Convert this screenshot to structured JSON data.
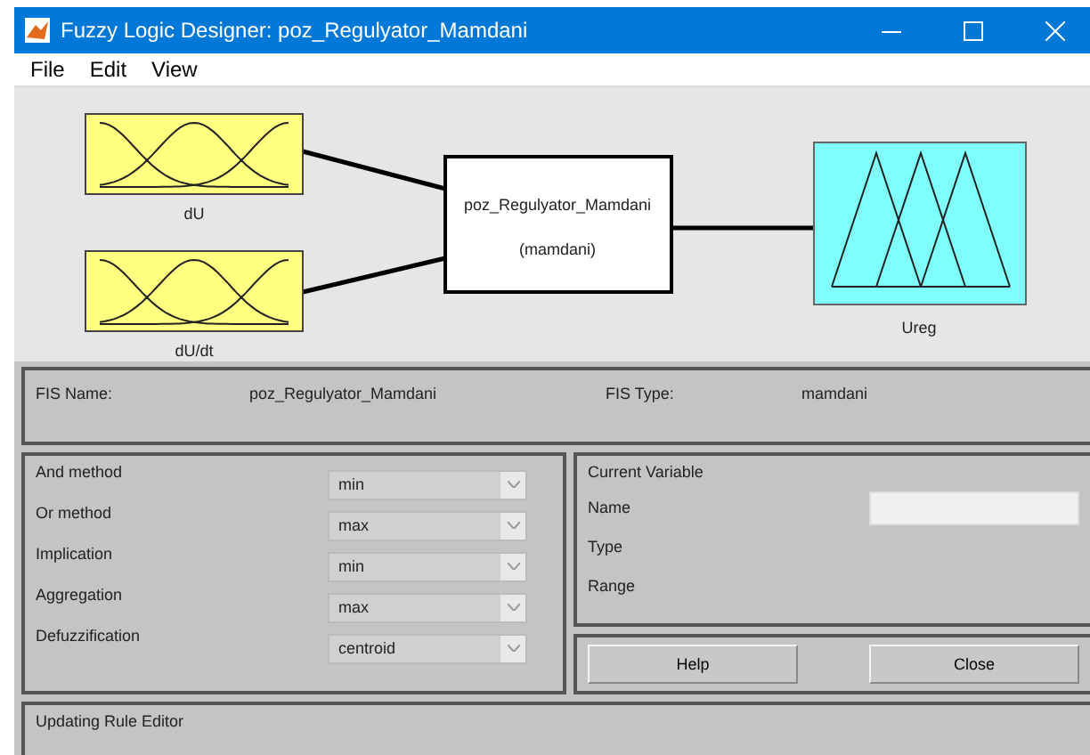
{
  "window": {
    "title": "Fuzzy Logic Designer: poz_Regulyator_Mamdani"
  },
  "menu": [
    "File",
    "Edit",
    "View"
  ],
  "diagram": {
    "inputs": [
      {
        "name": "dU"
      },
      {
        "name": "dU/dt"
      }
    ],
    "system": {
      "name": "poz_Regulyator_Mamdani",
      "type": "(mamdani)"
    },
    "outputs": [
      {
        "name": "Ureg"
      }
    ]
  },
  "fis_info": {
    "name_label": "FIS Name:",
    "name_value": "poz_Regulyator_Mamdani",
    "type_label": "FIS Type:",
    "type_value": "mamdani"
  },
  "methods": [
    {
      "label": "And method",
      "value": "min"
    },
    {
      "label": "Or method",
      "value": "max"
    },
    {
      "label": "Implication",
      "value": "min"
    },
    {
      "label": "Aggregation",
      "value": "max"
    },
    {
      "label": "Defuzzification",
      "value": "centroid"
    }
  ],
  "current_variable": {
    "title": "Current Variable",
    "fields": [
      {
        "label": "Name",
        "kind": "input"
      },
      {
        "label": "Type",
        "kind": "text"
      },
      {
        "label": "Range",
        "kind": "text"
      }
    ]
  },
  "buttons": [
    "Help",
    "Close"
  ],
  "status": "Updating Rule Editor"
}
